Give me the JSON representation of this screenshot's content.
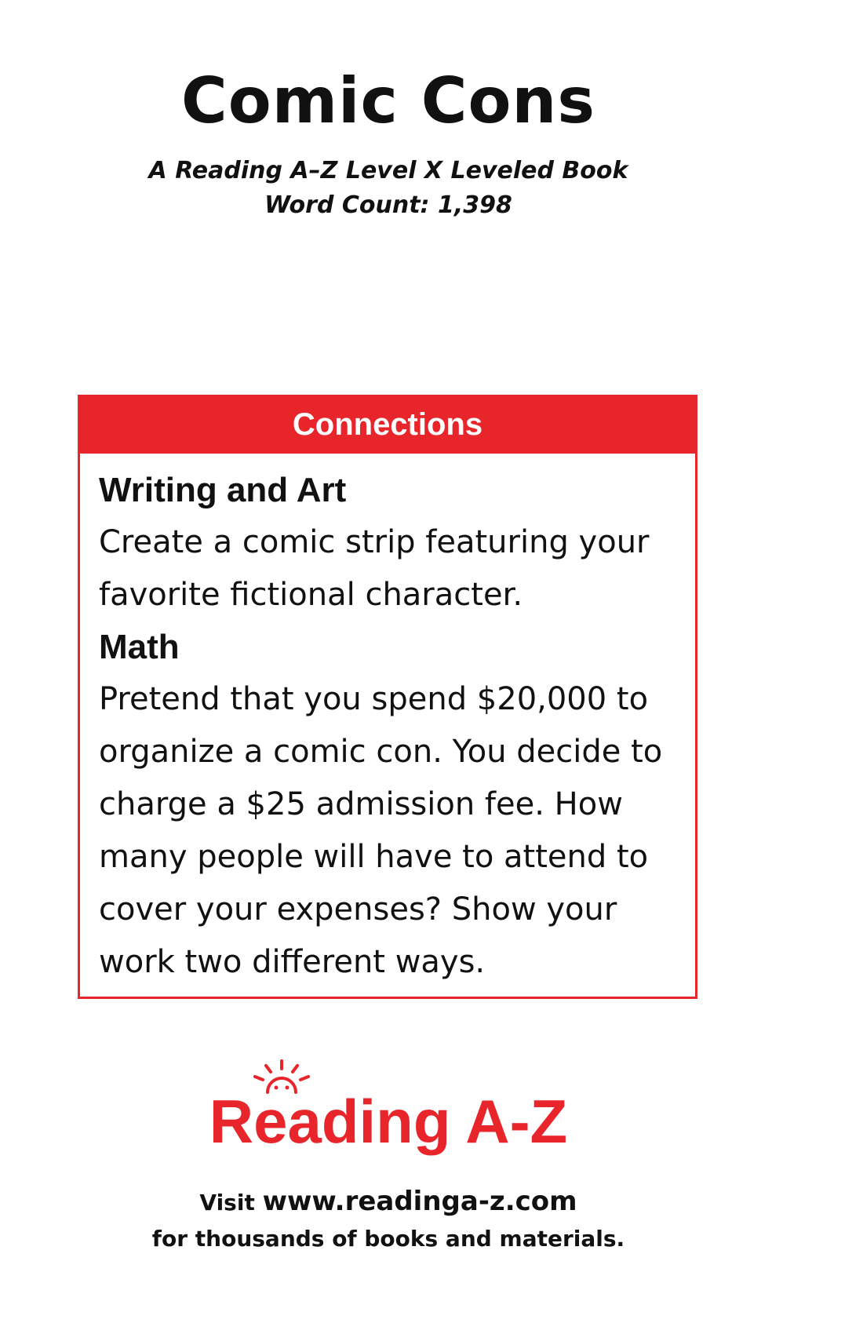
{
  "book": {
    "title": "Comic Cons",
    "level_line": "A Reading A–Z Level X Leveled Book",
    "word_count_line": "Word Count: 1,398"
  },
  "connections": {
    "header": "Connections",
    "sections": [
      {
        "heading": "Writing and Art",
        "body": "Create a comic strip featuring your favorite fictional character."
      },
      {
        "heading": "Math",
        "body": "Pretend that you spend $20,000 to organize a comic con. You decide to charge a $25 admission fee. How many people will have to attend to cover your expenses? Show your work two different ways."
      }
    ]
  },
  "logo": {
    "text": "Reading A-Z",
    "icon": "sun-icon",
    "color": "#e8252b"
  },
  "footer": {
    "visit": "Visit",
    "url": "www.readinga-z.com",
    "tagline": "for thousands of books and materials."
  }
}
